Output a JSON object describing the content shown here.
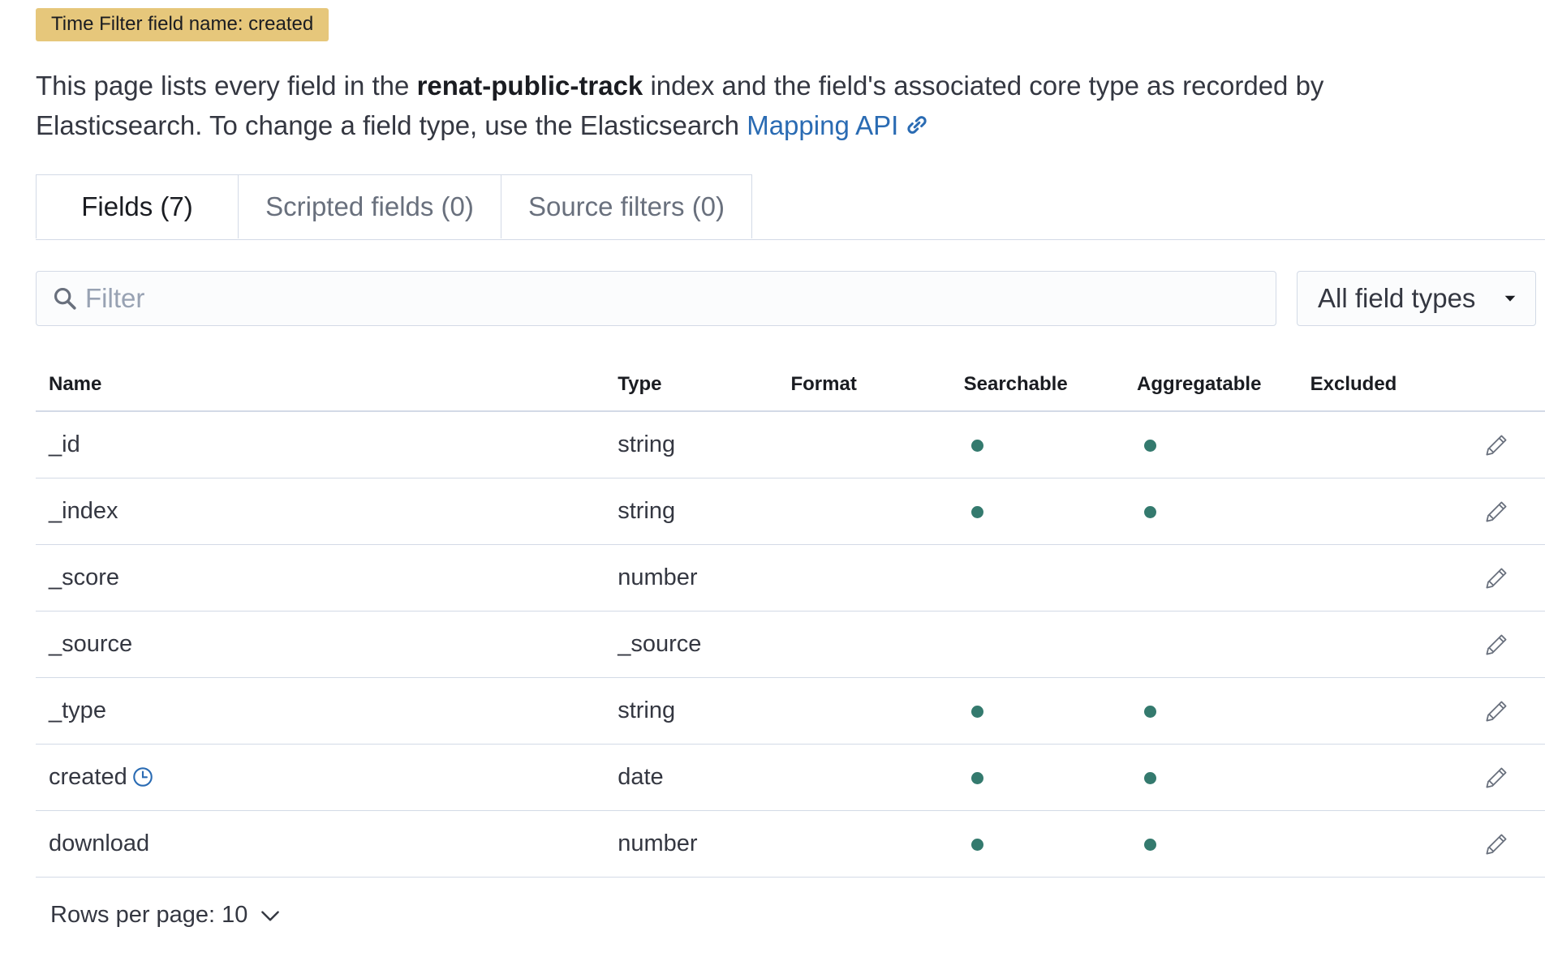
{
  "badge": {
    "label": "Time Filter field name: created"
  },
  "description": {
    "prefix": "This page lists every field in the ",
    "index_name": "renat-public-track",
    "suffix": " index and the field's associated core type as recorded by Elasticsearch. To change a field type, use the Elasticsearch ",
    "link_text": "Mapping API"
  },
  "tabs": [
    {
      "label": "Fields (7)",
      "active": true
    },
    {
      "label": "Scripted fields (0)",
      "active": false
    },
    {
      "label": "Source filters (0)",
      "active": false
    }
  ],
  "filter": {
    "placeholder": "Filter",
    "value": ""
  },
  "type_select": {
    "label": "All field types"
  },
  "table": {
    "columns": [
      "Name",
      "Type",
      "Format",
      "Searchable",
      "Aggregatable",
      "Excluded"
    ],
    "rows": [
      {
        "name": "_id",
        "type": "string",
        "format": "",
        "searchable": true,
        "aggregatable": true,
        "excluded": false,
        "time_field": false
      },
      {
        "name": "_index",
        "type": "string",
        "format": "",
        "searchable": true,
        "aggregatable": true,
        "excluded": false,
        "time_field": false
      },
      {
        "name": "_score",
        "type": "number",
        "format": "",
        "searchable": false,
        "aggregatable": false,
        "excluded": false,
        "time_field": false
      },
      {
        "name": "_source",
        "type": "_source",
        "format": "",
        "searchable": false,
        "aggregatable": false,
        "excluded": false,
        "time_field": false
      },
      {
        "name": "_type",
        "type": "string",
        "format": "",
        "searchable": true,
        "aggregatable": true,
        "excluded": false,
        "time_field": false
      },
      {
        "name": "created",
        "type": "date",
        "format": "",
        "searchable": true,
        "aggregatable": true,
        "excluded": false,
        "time_field": true
      },
      {
        "name": "download",
        "type": "number",
        "format": "",
        "searchable": true,
        "aggregatable": true,
        "excluded": false,
        "time_field": false
      }
    ]
  },
  "pagination": {
    "rows_per_page_label": "Rows per page: 10"
  },
  "icons": {
    "search": "search-icon",
    "link": "link-icon",
    "dropdown": "caret-down-icon",
    "time_field": "clock-icon",
    "edit": "pencil-icon",
    "rows_dropdown": "chevron-down-icon"
  },
  "colors": {
    "badge_bg": "#e6c77b",
    "link": "#2a6bb3",
    "dot": "#347a6e",
    "border": "#d3dae6"
  }
}
